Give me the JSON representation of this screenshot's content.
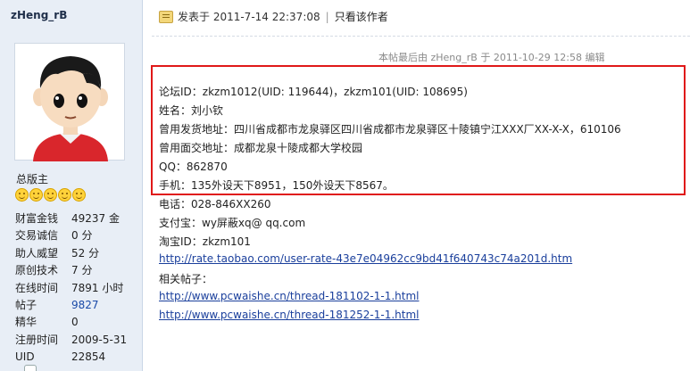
{
  "user": {
    "name": "zHeng_rB",
    "group": "总版主",
    "stars": 5,
    "stats": [
      {
        "key": "财富金钱",
        "value": "49237 金"
      },
      {
        "key": "交易诚信",
        "value": "0 分"
      },
      {
        "key": "助人威望",
        "value": "52 分"
      },
      {
        "key": "原创技术",
        "value": "7 分"
      },
      {
        "key": "在线时间",
        "value": "7891 小时"
      },
      {
        "key": "帖子",
        "value": "9827"
      },
      {
        "key": "精华",
        "value": "0"
      },
      {
        "key": "注册时间",
        "value": "2009-5-31"
      },
      {
        "key": "UID",
        "value": "22854"
      }
    ]
  },
  "post": {
    "posted_at": "发表于 2011-7-14 22:37:08",
    "separator": "|",
    "only_author": "只看该作者",
    "edit_note": "本帖最后由 zHeng_rB 于 2011-10-29 12:58 编辑",
    "highlighted_lines": [
      "论坛ID：zkzm1012(UID: 119644)，zkzm101(UID: 108695)",
      "姓名：刘小钦",
      "曾用发货地址：四川省成都市龙泉驿区四川省成都市龙泉驿区十陵镇宁江XXX厂XX-X-X，610106",
      "曾用面交地址：成都龙泉十陵成都大学校园",
      "QQ：862870",
      "手机：135外设天下8951，150外设天下8567。"
    ],
    "other_lines": [
      "电话：028-846XX260",
      "支付宝：wy屏蔽xq@ qq.com",
      "淘宝ID：zkzm101"
    ],
    "taobao_link": "http://rate.taobao.com/user-rate-43e7e04962cc9bd41f640743c74a201d.htm",
    "related_label": "相关帖子：",
    "related_links": [
      "http://www.pcwaishe.cn/thread-181102-1-1.html",
      "http://www.pcwaishe.cn/thread-181252-1-1.html"
    ]
  },
  "colors": {
    "highlight_border": "#e01818",
    "link": "#1a3f9c",
    "sidebar_bg": "#e8eef6"
  }
}
